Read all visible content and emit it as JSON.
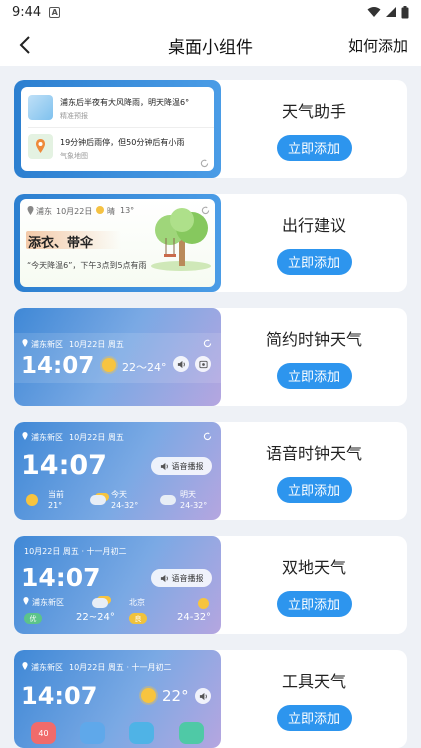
{
  "status_bar": {
    "time": "9:44",
    "notif_icon_letter": "A"
  },
  "header": {
    "title": "桌面小组件",
    "how_to_add": "如何添加"
  },
  "widgets": [
    {
      "name": "天气助手",
      "button": "立即添加",
      "preview": {
        "line1": "浦东后半夜有大风降雨，明天降温6°",
        "line1_sub": "精准预报",
        "line2": "19分钟后雨停，但50分钟后有小雨",
        "line2_sub": "气象地图"
      }
    },
    {
      "name": "出行建议",
      "button": "立即添加",
      "preview": {
        "location": "浦东",
        "date": "10月22日",
        "weather": "晴",
        "temp": "13°",
        "headline": "添衣、带伞",
        "tip": "“今天降温6”，下午3点到5点有雨"
      }
    },
    {
      "name": "简约时钟天气",
      "button": "立即添加",
      "preview": {
        "location": "浦东新区",
        "date": "10月22日 周五",
        "time": "14:07",
        "temp_range": "22～24°"
      }
    },
    {
      "name": "语音时钟天气",
      "button": "立即添加",
      "preview": {
        "location": "浦东新区",
        "date": "10月22日 周五",
        "time": "14:07",
        "voice": "语音播报",
        "days": [
          {
            "label": "当前",
            "temp": "21°"
          },
          {
            "label": "今天",
            "temp": "24-32°"
          },
          {
            "label": "明天",
            "temp": "24-32°"
          }
        ]
      }
    },
    {
      "name": "双地天气",
      "button": "立即添加",
      "preview": {
        "date": "10月22日 周五 · 十一月初二",
        "time": "14:07",
        "voice": "语音播报",
        "place1": "浦东新区",
        "aqi1": "优",
        "temp1": "22~24°",
        "place2": "北京",
        "aqi2": "良",
        "temp2": "24-32°"
      }
    },
    {
      "name": "工具天气",
      "button": "立即添加",
      "preview": {
        "location": "浦东新区",
        "date": "10月22日 周五 · 十一月初二",
        "time": "14:07",
        "temp": "22°",
        "tool1": "40"
      }
    }
  ]
}
